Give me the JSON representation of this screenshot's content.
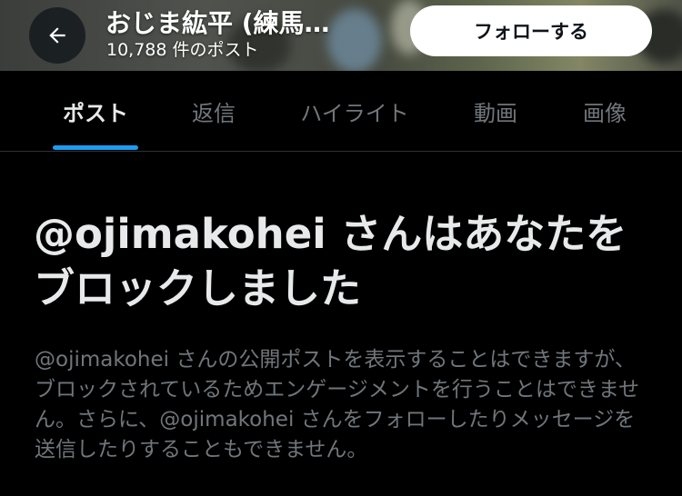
{
  "header": {
    "title": "おじま紘平 (練馬…",
    "post_count": "10,788 件のポスト",
    "follow_label": "フォローする",
    "back_icon": "arrow-left-icon"
  },
  "tabs": [
    {
      "label": "ポスト",
      "active": true
    },
    {
      "label": "返信",
      "active": false
    },
    {
      "label": "ハイライト",
      "active": false
    },
    {
      "label": "動画",
      "active": false
    },
    {
      "label": "画像",
      "active": false
    }
  ],
  "block_notice": {
    "title": "@ojimakohei さんはあなたをブロックしました",
    "description": "@ojimakohei さんの公開ポストを表示することはできますが、ブロックされているためエンゲージメントを行うことはできません。さらに、@ojimakohei さんをフォローしたりメッセージを送信したりすることもできません。"
  },
  "colors": {
    "background": "#000000",
    "accent": "#1d9bf0",
    "text_primary": "#e7e9ea",
    "text_secondary": "#71767b"
  }
}
